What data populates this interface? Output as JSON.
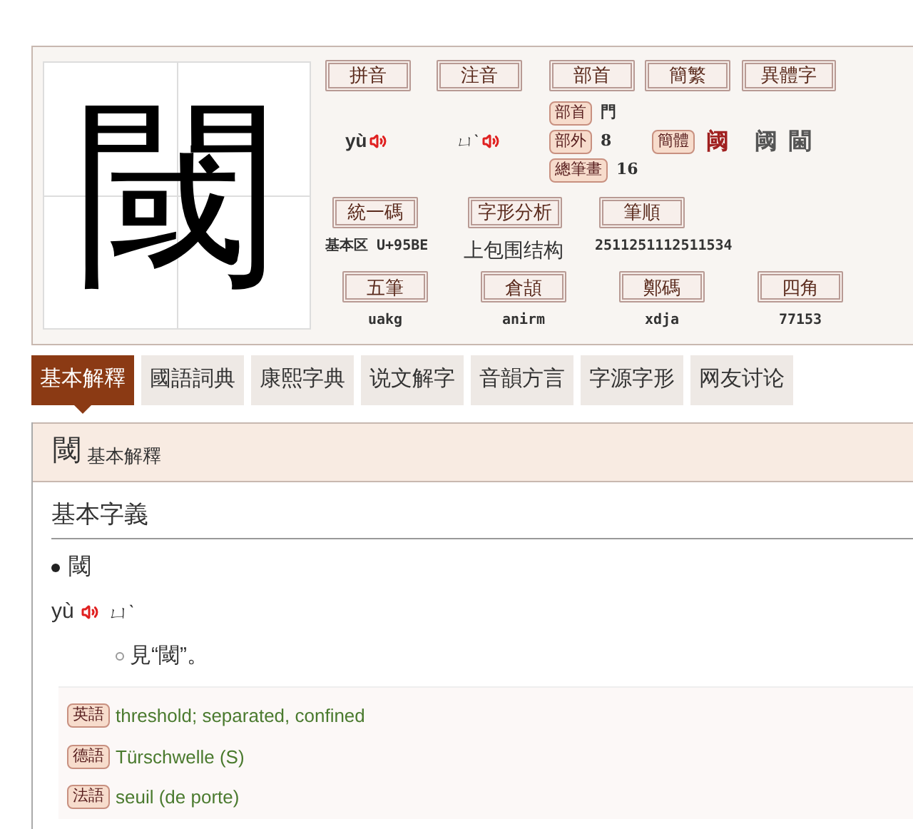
{
  "character": "閾",
  "pinyin": {
    "label": "拼音",
    "value": "yù"
  },
  "zhuyin": {
    "label": "注音",
    "value": "ㄩˋ"
  },
  "radical": {
    "label": "部首",
    "rows": [
      {
        "tag": "部首",
        "value": "門"
      },
      {
        "tag": "部外",
        "value": "8"
      },
      {
        "tag": "總筆畫",
        "value": "16"
      }
    ]
  },
  "simplified": {
    "label": "簡繁",
    "tag": "簡體",
    "value": "阈"
  },
  "variants": {
    "label": "異體字",
    "values": [
      "阈",
      "閫"
    ]
  },
  "codes": [
    {
      "label": "統一碼",
      "value": "基本区 U+95BE"
    },
    {
      "label": "字形分析",
      "value": "上包围结构"
    },
    {
      "label": "筆順",
      "value": "2511251112511534"
    }
  ],
  "input_codes": [
    {
      "label": "五筆",
      "value": "uakg"
    },
    {
      "label": "倉頡",
      "value": "anirm"
    },
    {
      "label": "鄭碼",
      "value": "xdja"
    },
    {
      "label": "四角",
      "value": "77153"
    }
  ],
  "tabs": [
    {
      "label": "基本解釋",
      "selected": true
    },
    {
      "label": "國語詞典",
      "selected": false
    },
    {
      "label": "康熙字典",
      "selected": false
    },
    {
      "label": "说文解字",
      "selected": false
    },
    {
      "label": "音韻方言",
      "selected": false
    },
    {
      "label": "字源字形",
      "selected": false
    },
    {
      "label": "网友讨论",
      "selected": false
    }
  ],
  "section": {
    "character": "閾",
    "title": "基本解釋"
  },
  "definition": {
    "heading": "基本字義",
    "headword": "閾",
    "pinyin": "yù",
    "zhuyin": "ㄩˋ",
    "meanings": [
      "見“閾”。"
    ]
  },
  "translations": [
    {
      "tag": "英語",
      "text": "threshold; separated, confined"
    },
    {
      "tag": "德語",
      "text": "Türschwelle (S)"
    },
    {
      "tag": "法語",
      "text": "seuil (de porte)"
    }
  ]
}
